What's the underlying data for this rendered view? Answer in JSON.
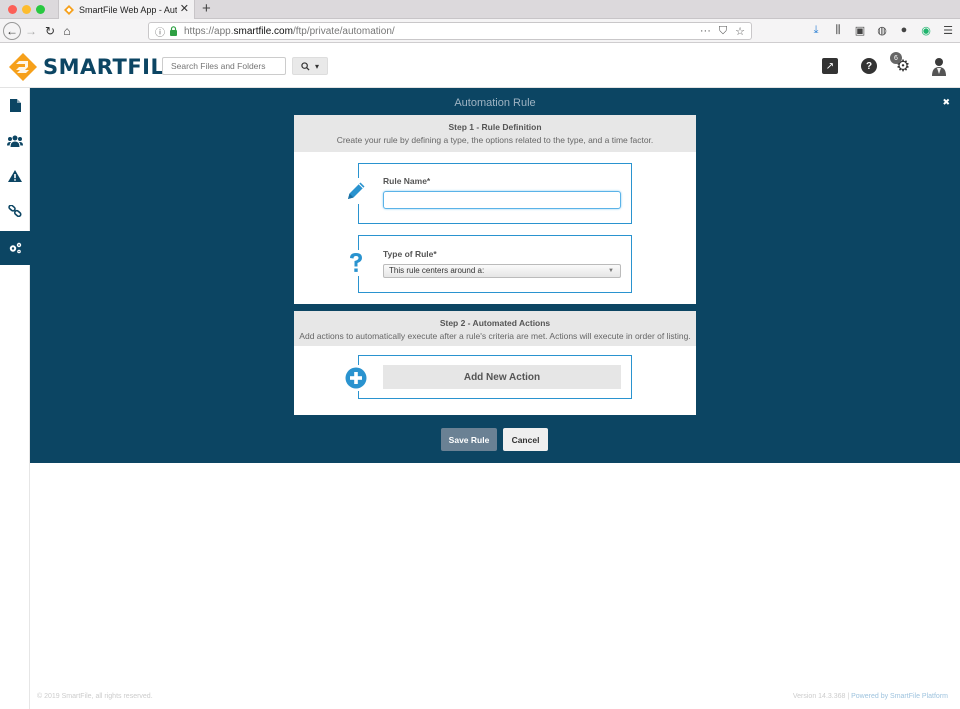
{
  "browser": {
    "tab_title": "SmartFile Web App - Automatio",
    "tab_close": "✕",
    "new_tab": "+",
    "url_prefix": "https://app.",
    "url_host": "smartfile.com",
    "url_path": "/ftp/private/automation/",
    "url_more": "···"
  },
  "header": {
    "logo_text": "SMARTFILE",
    "search_placeholder": "Search Files and Folders",
    "notifications_count": "6"
  },
  "panel": {
    "title": "Automation Rule",
    "close": "✖",
    "step1": {
      "title": "Step 1 - Rule Definition",
      "description": "Create your rule by defining a type, the options related to the type, and a time factor.",
      "rule_name_label": "Rule Name*",
      "rule_name_value": "",
      "type_label": "Type of Rule*",
      "type_selected": "This rule centers around a:"
    },
    "step2": {
      "title": "Step 2 - Automated Actions",
      "description": "Add actions to automatically execute after a rule's criteria are met. Actions will execute in order of listing.",
      "add_action_label": "Add New Action"
    },
    "save_label": "Save Rule",
    "cancel_label": "Cancel"
  },
  "footer": {
    "copyright": "© 2019 SmartFile, all rights reserved.",
    "version": "Version 14.3.368 | ",
    "powered": "Powered by SmartFile Platform"
  },
  "colors": {
    "brand_navy": "#0c4563",
    "brand_orange": "#f6a01a",
    "accent_blue": "#2a93cf"
  }
}
